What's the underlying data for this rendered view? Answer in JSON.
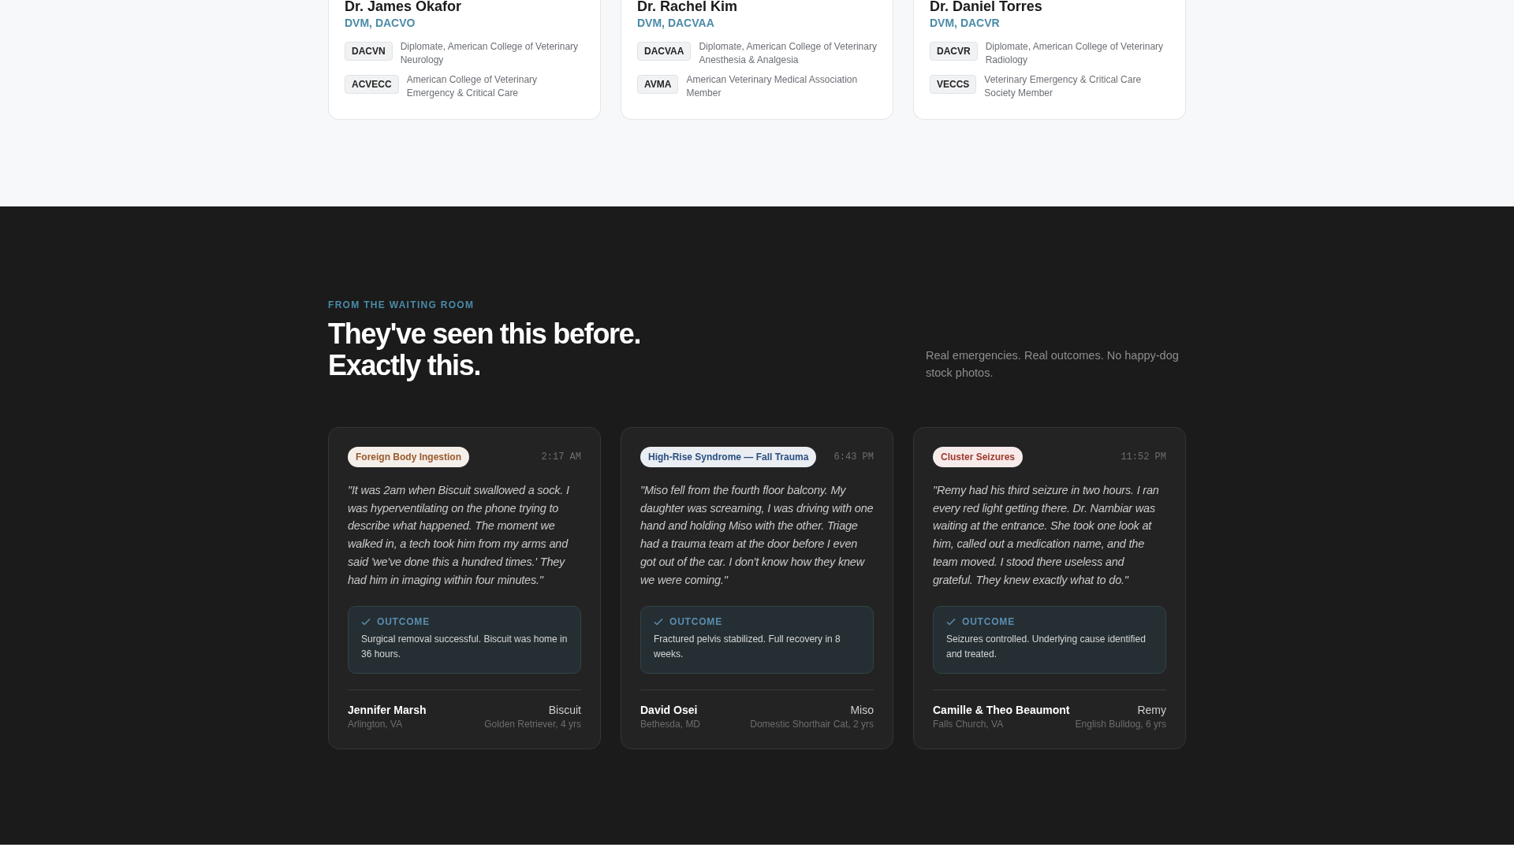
{
  "specialists": [
    {
      "name": "Dr. James Okafor",
      "credentials": "DVM, DACVO",
      "certifications": [
        {
          "code": "DACVN",
          "description": "Diplomate, American College of Veterinary Neurology"
        },
        {
          "code": "ACVECC",
          "description": "American College of Veterinary Emergency & Critical Care"
        }
      ]
    },
    {
      "name": "Dr. Rachel Kim",
      "credentials": "DVM, DACVAA",
      "certifications": [
        {
          "code": "DACVAA",
          "description": "Diplomate, American College of Veterinary Anesthesia & Analgesia"
        },
        {
          "code": "AVMA",
          "description": "American Veterinary Medical Association Member"
        }
      ]
    },
    {
      "name": "Dr. Daniel Torres",
      "credentials": "DVM, DACVR",
      "certifications": [
        {
          "code": "DACVR",
          "description": "Diplomate, American College of Veterinary Radiology"
        },
        {
          "code": "VECCS",
          "description": "Veterinary Emergency & Critical Care Society Member"
        }
      ]
    }
  ],
  "testimonials_section": {
    "eyebrow": "FROM THE WAITING ROOM",
    "heading_lines": [
      "They've seen this before.",
      "Exactly this."
    ],
    "subtext": "Real emergencies. Real outcomes. No happy-dog stock photos.",
    "testimonials": [
      {
        "tag": {
          "label": "Foreign Body Ingestion",
          "color": "#9a5a2a"
        },
        "time": "2:17 AM",
        "quote": "\"It was 2am when Biscuit swallowed a sock. I was hyperventilating on the phone trying to describe what happened. The moment we walked in, a tech took him from my arms and said 'we've done this a hundred times.' They had him in imaging within four minutes.\"",
        "outcome_label": "OUTCOME",
        "outcome": "Surgical removal successful. Biscuit was home in 36 hours.",
        "owner": "Jennifer Marsh",
        "location": "Arlington, VA",
        "pet": "Biscuit",
        "breed": "Golden Retriever, 4 yrs"
      },
      {
        "tag": {
          "label": "High-Rise Syndrome — Fall Trauma",
          "color": "#2a4f80"
        },
        "time": "6:43 PM",
        "quote": "\"Miso fell from the fourth floor balcony. My daughter was screaming, I was driving with one hand and holding Miso with the other. Triage had a trauma team at the door before I even got out of the car. I don't know how they knew we were coming.\"",
        "outcome_label": "OUTCOME",
        "outcome": "Fractured pelvis stabilized. Full recovery in 8 weeks.",
        "owner": "David Osei",
        "location": "Bethesda, MD",
        "pet": "Miso",
        "breed": "Domestic Shorthair Cat, 2 yrs"
      },
      {
        "tag": {
          "label": "Cluster Seizures",
          "color": "#a0392e"
        },
        "time": "11:52 PM",
        "quote": "\"Remy had his third seizure in two hours. I ran every red light getting there. Dr. Nambiar was waiting at the entrance. She took one look at him, called out a medication name, and the team moved. I stood there useless and grateful. They knew exactly what to do.\"",
        "outcome_label": "OUTCOME",
        "outcome": "Seizures controlled. Underlying cause identified and treated.",
        "owner": "Camille & Theo Beaumont",
        "location": "Falls Church, VA",
        "pet": "Remy",
        "breed": "English Bulldog, 6 yrs"
      }
    ]
  }
}
